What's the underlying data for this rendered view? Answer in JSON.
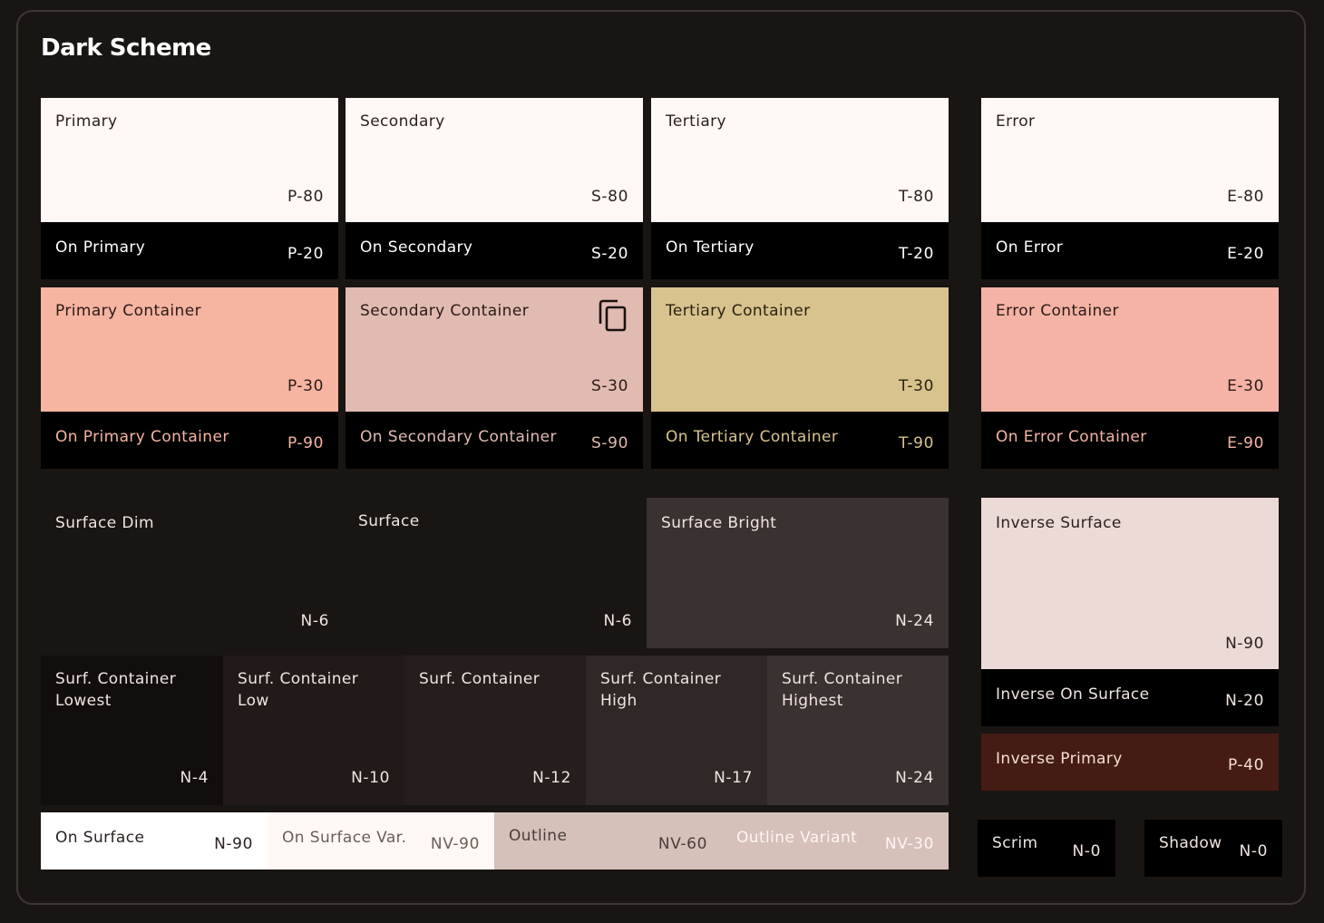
{
  "title": "Dark Scheme",
  "colors": {
    "background": "#191513",
    "panel_border": "#3d3835",
    "light_tile": "#fff8f5",
    "black": "#000000",
    "primary_container": "#f6b4a1",
    "secondary_container": "#e1bab2",
    "tertiary_container": "#d8c38e",
    "error_container": "#f5b3a6",
    "on_primary_container": "#f6b4a1",
    "on_secondary_container": "#e1bab2",
    "on_tertiary_container": "#d8c38e",
    "on_error_container": "#f5b3a6",
    "surface_bright": "#3a3230",
    "surf_container_lowest": "#120e0d",
    "surf_container_low": "#211a19",
    "surf_container": "#251e1c",
    "surf_container_high": "#2f2826",
    "surf_container_highest": "#3a3230",
    "inverse_surface": "#ecdad6",
    "inverse_primary": "#441c13",
    "outline": "#d5c0ba",
    "outline_variant": "#d5c0ba"
  },
  "accent_tiles": {
    "primary": {
      "label": "Primary",
      "code": "P-80"
    },
    "on_primary": {
      "label": "On Primary",
      "code": "P-20"
    },
    "primary_container": {
      "label": "Primary Container",
      "code": "P-30"
    },
    "on_primary_container": {
      "label": "On Primary Container",
      "code": "P-90"
    },
    "secondary": {
      "label": "Secondary",
      "code": "S-80"
    },
    "on_secondary": {
      "label": "On Secondary",
      "code": "S-20"
    },
    "secondary_container": {
      "label": "Secondary Container",
      "code": "S-30",
      "icon": "copy-icon"
    },
    "on_secondary_container": {
      "label": "On Secondary Container",
      "code": "S-90"
    },
    "tertiary": {
      "label": "Tertiary",
      "code": "T-80"
    },
    "on_tertiary": {
      "label": "On Tertiary",
      "code": "T-20"
    },
    "tertiary_container": {
      "label": "Tertiary Container",
      "code": "T-30"
    },
    "on_tertiary_container": {
      "label": "On Tertiary Container",
      "code": "T-90"
    },
    "error": {
      "label": "Error",
      "code": "E-80"
    },
    "on_error": {
      "label": "On Error",
      "code": "E-20"
    },
    "error_container": {
      "label": "Error Container",
      "code": "E-30"
    },
    "on_error_container": {
      "label": "On Error Container",
      "code": "E-90"
    }
  },
  "surfaces": {
    "surface_dim": {
      "label": "Surface Dim",
      "code": "N-6"
    },
    "surface": {
      "label": "Surface",
      "code": "N-6"
    },
    "surface_bright": {
      "label": "Surface Bright",
      "code": "N-24"
    },
    "containers": [
      {
        "label": "Surf. Container Lowest",
        "code": "N-4"
      },
      {
        "label": "Surf. Container Low",
        "code": "N-10"
      },
      {
        "label": "Surf. Container",
        "code": "N-12"
      },
      {
        "label": "Surf. Container High",
        "code": "N-17"
      },
      {
        "label": "Surf. Container Highest",
        "code": "N-24"
      }
    ],
    "on_surface": {
      "label": "On Surface",
      "code": "N-90"
    },
    "on_surface_var": {
      "label": "On Surface Var.",
      "code": "NV-90"
    },
    "outline": {
      "label": "Outline",
      "code": "NV-60"
    },
    "outline_variant": {
      "label": "Outline Variant",
      "code": "NV-30"
    }
  },
  "inverse": {
    "inverse_surface": {
      "label": "Inverse Surface",
      "code": "N-90"
    },
    "inverse_on_surface": {
      "label": "Inverse On Surface",
      "code": "N-20"
    },
    "inverse_primary": {
      "label": "Inverse Primary",
      "code": "P-40"
    }
  },
  "misc": {
    "scrim": {
      "label": "Scrim",
      "code": "N-0"
    },
    "shadow": {
      "label": "Shadow",
      "code": "N-0"
    }
  }
}
